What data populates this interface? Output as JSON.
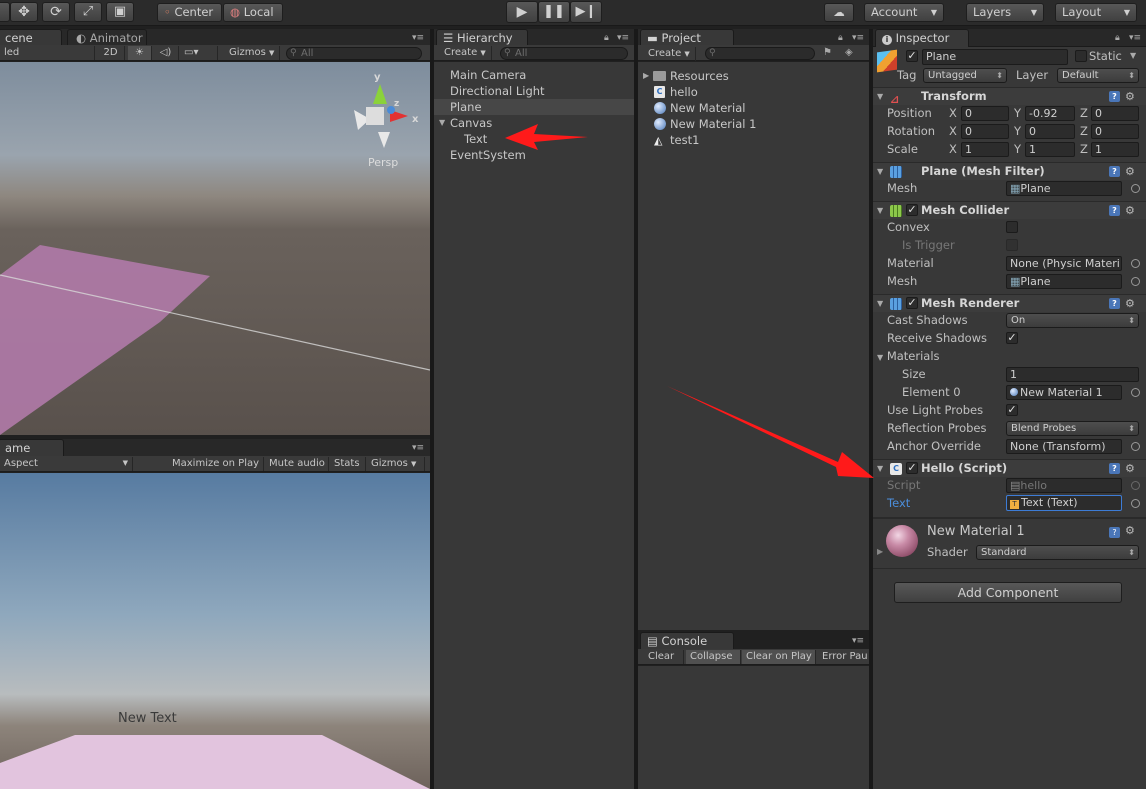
{
  "toolbar": {
    "tools": [
      "hand-tool",
      "move-tool",
      "rotate-tool",
      "scale-tool",
      "rect-tool"
    ],
    "pivot_label": "Center",
    "space_label": "Local",
    "account_label": "Account",
    "layers_label": "Layers",
    "layout_label": "Layout"
  },
  "scene": {
    "tab_scene": "cene",
    "tab_animator": "Animator",
    "shading": "led",
    "mode_2d": "2D",
    "gizmos": "Gizmos",
    "search_placeholder": "All",
    "gizmo_label": "Persp",
    "axis_y": "y",
    "axis_x": "x",
    "axis_z": "z"
  },
  "game": {
    "tab_game": "ame",
    "aspect": "Aspect",
    "maximize": "Maximize on Play",
    "mute": "Mute audio",
    "stats": "Stats",
    "gizmos": "Gizmos",
    "canvas_text": "New Text"
  },
  "hierarchy": {
    "tab": "Hierarchy",
    "create": "Create",
    "search_placeholder": "All",
    "items": [
      {
        "label": "Main Camera",
        "indent": 0
      },
      {
        "label": "Directional Light",
        "indent": 0
      },
      {
        "label": "Plane",
        "indent": 0,
        "selected": true
      },
      {
        "label": "Canvas",
        "indent": 0,
        "expanded": true
      },
      {
        "label": "Text",
        "indent": 1
      },
      {
        "label": "EventSystem",
        "indent": 0
      }
    ]
  },
  "project": {
    "tab": "Project",
    "create": "Create",
    "items": [
      "Resources",
      "hello",
      "New Material",
      "New Material 1",
      "test1"
    ]
  },
  "console": {
    "tab": "Console",
    "clear": "Clear",
    "collapse": "Collapse",
    "clear_on_play": "Clear on Play",
    "error_pause": "Error Pau"
  },
  "inspector": {
    "tab": "Inspector",
    "object_name": "Plane",
    "static_label": "Static",
    "tag_label": "Tag",
    "tag_value": "Untagged",
    "layer_label": "Layer",
    "layer_value": "Default",
    "transform": {
      "title": "Transform",
      "position_label": "Position",
      "rotation_label": "Rotation",
      "scale_label": "Scale",
      "axis_x": "X",
      "axis_y": "Y",
      "axis_z": "Z",
      "position": [
        "0",
        "-0.92",
        "0"
      ],
      "rotation": [
        "0",
        "0",
        "0"
      ],
      "scale": [
        "1",
        "1",
        "1"
      ]
    },
    "mesh_filter": {
      "title": "Plane (Mesh Filter)",
      "mesh_label": "Mesh",
      "mesh_value": "Plane"
    },
    "mesh_collider": {
      "title": "Mesh Collider",
      "convex_label": "Convex",
      "is_trigger_label": "Is Trigger",
      "material_label": "Material",
      "material_value": "None (Physic Materi",
      "mesh_label": "Mesh",
      "mesh_value": "Plane"
    },
    "mesh_renderer": {
      "title": "Mesh Renderer",
      "cast_shadows_label": "Cast Shadows",
      "cast_shadows_value": "On",
      "receive_shadows_label": "Receive Shadows",
      "materials_label": "Materials",
      "size_label": "Size",
      "size_value": "1",
      "element0_label": "Element 0",
      "element0_value": "New Material 1",
      "light_probes_label": "Use Light Probes",
      "reflection_probes_label": "Reflection Probes",
      "reflection_probes_value": "Blend Probes",
      "anchor_override_label": "Anchor Override",
      "anchor_override_value": "None (Transform)"
    },
    "hello_script": {
      "title": "Hello (Script)",
      "script_label": "Script",
      "script_value": "hello",
      "text_label": "Text",
      "text_value": "Text (Text)"
    },
    "material": {
      "name": "New Material 1",
      "shader_label": "Shader",
      "shader_value": "Standard"
    },
    "add_component": "Add Component"
  },
  "colors": {
    "accent_selected": "#4a6d9c",
    "arrow_red": "#ff1a1a",
    "plane_pink": "#b07aa8"
  }
}
